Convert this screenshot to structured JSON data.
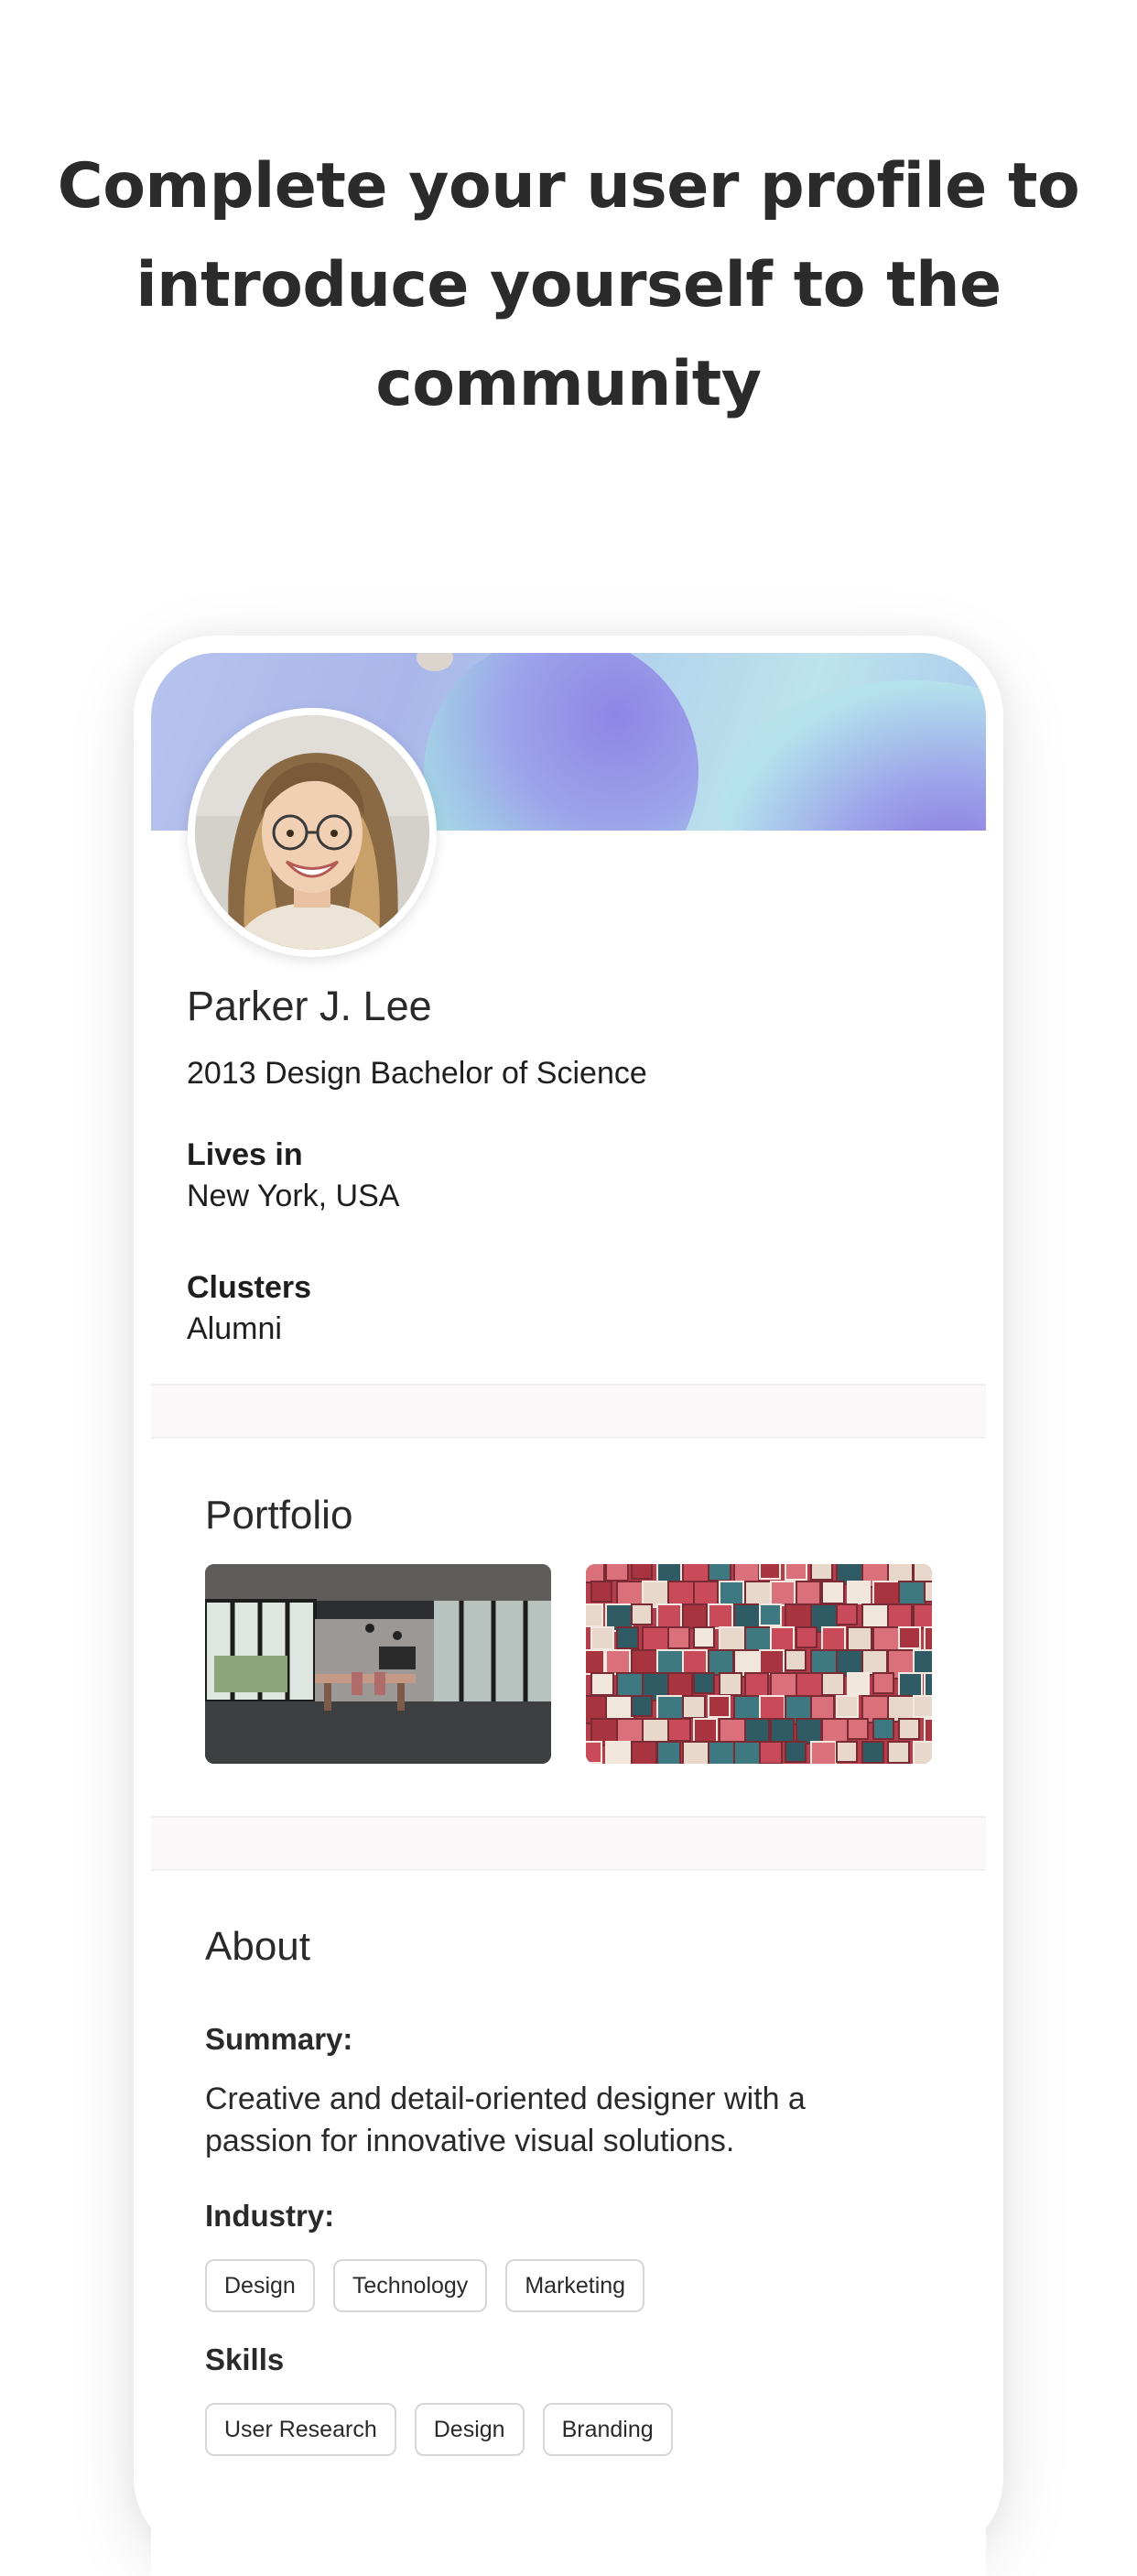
{
  "headline": "Complete your user profile to introduce yourself to the community",
  "profile": {
    "name": "Parker J. Lee",
    "degree": "2013 Design Bachelor of Science",
    "lives_in_label": "Lives in",
    "lives_in_value": "New York, USA",
    "clusters_label": "Clusters",
    "clusters_value": "Alumni"
  },
  "portfolio": {
    "title": "Portfolio",
    "items": [
      "office-interior-photo",
      "3d-cubes-artwork"
    ]
  },
  "about": {
    "title": "About",
    "summary_label": "Summary:",
    "summary_text": "Creative and detail-oriented designer with a passion for innovative visual solutions.",
    "industry_label": "Industry:",
    "industry_tags": [
      "Design",
      "Technology",
      "Marketing"
    ],
    "skills_label": "Skills",
    "skills_tags": [
      "User Research",
      "Design",
      "Branding"
    ]
  },
  "colors": {
    "text": "#2a2a2a",
    "chip_border": "#d6d6d6",
    "divider": "#faf8f8",
    "banner_accent": "#8f85e6"
  }
}
